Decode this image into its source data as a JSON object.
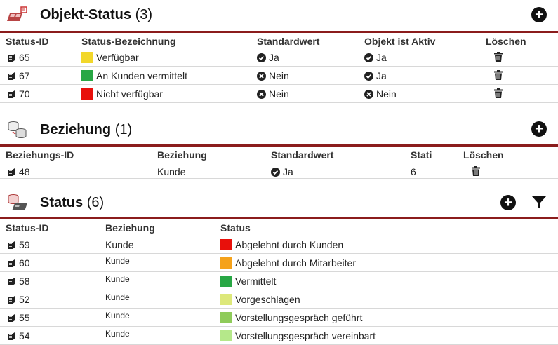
{
  "objekt_status": {
    "title": "Objekt-Status",
    "count": "(3)",
    "headers": {
      "id": "Status-ID",
      "name": "Status-Bezeichnung",
      "default": "Standardwert",
      "active": "Objekt ist Aktiv",
      "delete": "Löschen"
    },
    "rows": [
      {
        "id": "65",
        "color": "#f2d72b",
        "name": "Verfügbar",
        "default": "Ja",
        "default_icon": "check-circle-icon",
        "active": "Ja",
        "active_icon": "check-circle-icon"
      },
      {
        "id": "67",
        "color": "#28a745",
        "name": "An Kunden vermittelt",
        "default": "Nein",
        "default_icon": "x-circle-icon",
        "active": "Ja",
        "active_icon": "check-circle-icon"
      },
      {
        "id": "70",
        "color": "#e8100b",
        "name": "Nicht verfügbar",
        "default": "Nein",
        "default_icon": "x-circle-icon",
        "active": "Nein",
        "active_icon": "x-circle-icon"
      }
    ]
  },
  "beziehung": {
    "title": "Beziehung",
    "count": "(1)",
    "headers": {
      "id": "Beziehungs-ID",
      "name": "Beziehung",
      "default": "Standardwert",
      "stati": "Stati",
      "delete": "Löschen"
    },
    "rows": [
      {
        "id": "48",
        "name": "Kunde",
        "default": "Ja",
        "default_icon": "check-circle-icon",
        "stati": "6"
      }
    ]
  },
  "status": {
    "title": "Status",
    "count": "(6)",
    "headers": {
      "id": "Status-ID",
      "beziehung": "Beziehung",
      "status": "Status"
    },
    "rows": [
      {
        "id": "59",
        "beziehung": "Kunde",
        "color": "#e8100b",
        "status": "Abgelehnt durch Kunden"
      },
      {
        "id": "60",
        "beziehung": "Kunde",
        "color": "#f5a21b",
        "status": "Abgelehnt durch Mitarbeiter"
      },
      {
        "id": "58",
        "beziehung": "Kunde",
        "color": "#28a745",
        "status": "Vermittelt"
      },
      {
        "id": "52",
        "beziehung": "Kunde",
        "color": "#dde87a",
        "status": "Vorgeschlagen"
      },
      {
        "id": "55",
        "beziehung": "Kunde",
        "color": "#8fcb5a",
        "status": "Vorstellungsgespräch geführt"
      },
      {
        "id": "54",
        "beziehung": "Kunde",
        "color": "#b5e88a",
        "status": "Vorstellungsgespräch vereinbart"
      }
    ]
  },
  "icons": {
    "add": "plus-circle-icon",
    "filter": "filter-icon",
    "delete": "trash-icon",
    "record": "document-icon"
  }
}
